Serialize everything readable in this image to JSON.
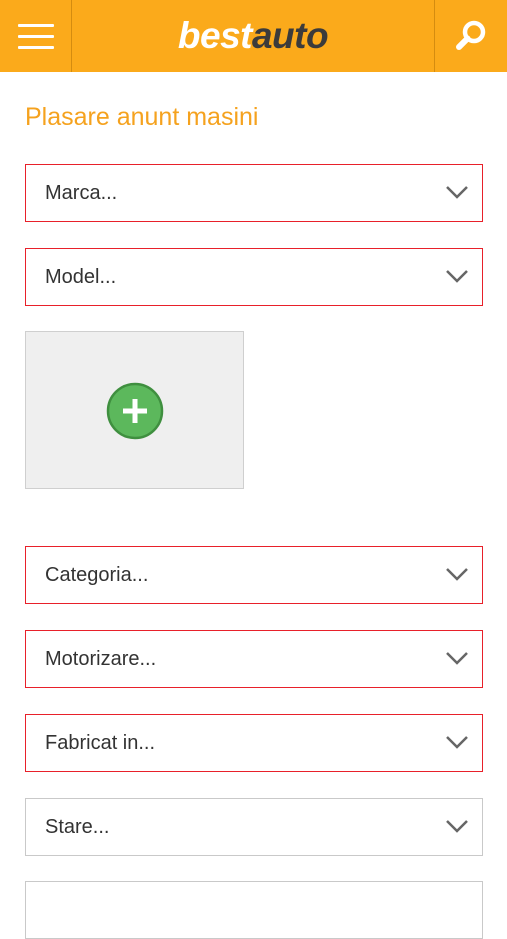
{
  "header": {
    "logo_best": "best",
    "logo_auto": "auto",
    "menu_icon": "hamburger-menu-icon",
    "search_icon": "search-icon",
    "bar_color": "#fbaa1b"
  },
  "form": {
    "title": "Plasare anunt masini",
    "marca": "Marca...",
    "model": "Model...",
    "add_photo_icon": "plus-circle-icon",
    "categoria": "Categoria...",
    "motorizare": "Motorizare...",
    "fabricat_in": "Fabricat in...",
    "stare": "Stare..."
  },
  "colors": {
    "accent": "#f5a21e",
    "required_border": "#e8202a",
    "add_button": "#5cb85c"
  }
}
